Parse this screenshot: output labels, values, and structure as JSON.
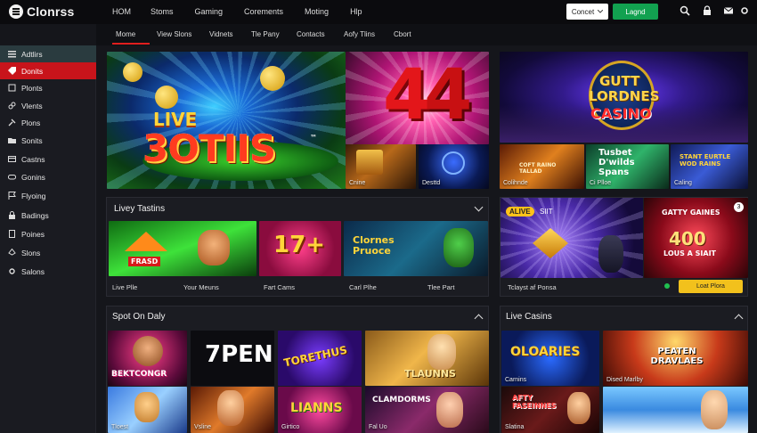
{
  "brand": {
    "name": "Clonrss"
  },
  "main_nav": [
    "HOM",
    "Stoms",
    "Gaming",
    "Corements",
    "Moting",
    "Hlp"
  ],
  "header_actions": {
    "connect_label": "Concet",
    "login_label": "Lagnd"
  },
  "sub_nav": [
    "Mome",
    "View Slons",
    "Vidnets",
    "Tle Pany",
    "Contacts",
    "Aofy Tlins",
    "Cbort"
  ],
  "sidebar": [
    "Adtlirs",
    "Donits",
    "Plonts",
    "Vlents",
    "Plons",
    "Sonits",
    "Castns",
    "Gonins",
    "Flyoing",
    "Badings",
    "Poines",
    "Slons",
    "Salons"
  ],
  "hero": {
    "live_word": "LIVE",
    "big_title": "3OTIIS",
    "tm": "™",
    "number": "4",
    "small_tiles": [
      "Cnine",
      "Desttd"
    ]
  },
  "feature_right": {
    "logo_line1": "GUTT",
    "logo_line2": "LORDNES",
    "logo_line3": "CASINO",
    "tiles": [
      {
        "text": "COFT RAINO TALLAD",
        "label": "Colihnde"
      },
      {
        "text": "Tusbet D'wilds Spans",
        "label": "Ci Plloe"
      },
      {
        "text": "STANT EURTLE WOD RAINS",
        "label": "Caling"
      }
    ]
  },
  "live_tastins": {
    "title": "Livey Tastins",
    "tiles": [
      {
        "art": "FRASD",
        "caption": "Live Plle"
      },
      {
        "caption": "Your Meuns"
      },
      {
        "art": "17+",
        "caption": "Fart Cams"
      },
      {
        "art": "Clornes Pruoce",
        "caption": "Carl Plhe"
      },
      {
        "caption": "Tlee Part"
      }
    ]
  },
  "promo": {
    "badge": "ALIVE",
    "badge_text": "SIIT",
    "caption": "Tclayst af Ponsa",
    "counter": "3",
    "right_title": "GATTY GAINES",
    "right_amount": "400",
    "right_sub": "LOUS A SIAIT",
    "button_label": "Loat Plora"
  },
  "spot_on_daly": {
    "title": "Spot On Daly",
    "tiles": [
      {
        "art": "BEKTCONGR"
      },
      {
        "art": "7PEN"
      },
      {
        "art": "TORETHUS"
      },
      {
        "art": "TLAUNNS"
      },
      {
        "label": "Tloest"
      },
      {
        "label": "Vsline"
      },
      {
        "art": "LIANNS",
        "label": "Girtico"
      },
      {
        "art": "CLAMDORMS",
        "label": "Fal Uo"
      }
    ]
  },
  "live_casins": {
    "title": "Live Casins",
    "tiles": [
      {
        "art": "OLOARIES",
        "label": "Carnins"
      },
      {
        "art": "PEATEN DRAVLAES",
        "label": "Dised Marlby"
      },
      {
        "art": "AFTY FASEINNES",
        "label": "Slatina"
      },
      {
        "label": ""
      }
    ]
  }
}
